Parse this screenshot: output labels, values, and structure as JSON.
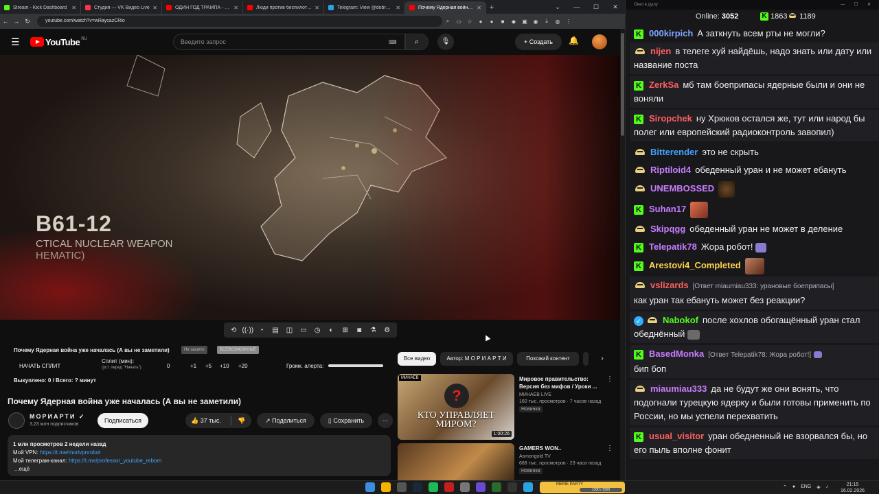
{
  "browser": {
    "tabs": [
      {
        "label": "Stream - Kick Dashboard",
        "color": "#53fc18"
      },
      {
        "label": "Студия — VK Видео Live",
        "color": "#ff3347"
      },
      {
        "label": "ОДИН ГОД ТРАМПА - YouTube",
        "color": "#ff0000"
      },
      {
        "label": "Люди против беспилотн: сем",
        "color": "#ff0000"
      },
      {
        "label": "Telegram: View @dobro_2ch",
        "color": "#2aa4e0"
      },
      {
        "label": "Почему Ядерная война у",
        "color": "#ff0000"
      }
    ],
    "url": "youtube.com/watch?v=wRaycazCRio"
  },
  "youtube": {
    "logo_text": "YouTube",
    "region": "RU",
    "search_placeholder": "Введите запрос",
    "create_label": "Создать",
    "video_overlay": {
      "line1": "B61-12",
      "line2": "CTICAL NUCLEAR WEAPON",
      "line3": "HEMATIC)"
    },
    "ext": {
      "title": "Почему Ядерная война уже началась (А вы не заметили)",
      "tag1": "Не зашито",
      "tag2": "ВСЕВОЗМОЖНЫЕ",
      "start_split": "НАЧАТЬ СПЛИТ",
      "split_label": "Сплит (мин):",
      "split_sub": "(уст. перед \"Начать\")",
      "zero": "0",
      "inc": [
        "+1",
        "+5",
        "+10",
        "+20"
      ],
      "loud_label": "Громк. алерта:",
      "bought": "Выкуплено: 0 / Всего: ? минут"
    },
    "video_title": "Почему Ядерная война уже началась (А вы не заметили)",
    "channel_name": "МОРИАРТИ",
    "channel_subs": "3,23 млн подписчиков",
    "subscribe_label": "Подписаться",
    "likes": "37 тыс.",
    "share_label": "Поделиться",
    "save_label": "Сохранить",
    "description": {
      "stats": "1 млн просмотров  2 недели назад",
      "vpn_label": "Мой VPN: ",
      "vpn_link": "https://t.me/morivpnrobot",
      "tg_label": "Мой телеграм-канал: ",
      "tg_link": "https://t.me/professor_youtube_reborn",
      "more": "...ещё"
    },
    "chips": [
      "Все видео",
      "Автор: М О Р И А Р Т И",
      "Похожий контент"
    ],
    "recommended": [
      {
        "title": "Мировое правительство: Версия без мифов / Уроки ...",
        "channel": "МИНАЕВ LIVE",
        "meta": "160 тыс. просмотров · 7 часов назад",
        "badge": "Новинка",
        "duration": "1:00:26",
        "thumb_badge": "МИНАЕВ",
        "thumb_text": "КТО УПРАВЛЯЕТ МИРОМ?"
      },
      {
        "title": "GAMERS WON..",
        "channel": "Asmongold TV",
        "meta": "668 тыс. просмотров · 23 часа назад",
        "badge": "Новинка"
      }
    ]
  },
  "chat": {
    "window_title": "Окно в душу",
    "online_label": "Online: ",
    "online_count": "3052",
    "kick_count": "1863",
    "yt_count": "1189",
    "messages": [
      {
        "user": "000kirpich",
        "color": "#7ea6ff",
        "badge": "kick",
        "text": "А заткнуть всем рты не могли?"
      },
      {
        "user": "nijen",
        "color": "#ff5f5f",
        "badge": "yt",
        "text": "в телеге хуй найдёшь, надо знать или дату или название поста"
      },
      {
        "user": "ZerkSa",
        "color": "#ff5f5f",
        "badge": "kick",
        "text": "мб там боеприпасы ядерные были и они не воняли"
      },
      {
        "user": "Siropchek",
        "color": "#ff5f5f",
        "badge": "kick",
        "text": "ну Хрюков остался же, тут или народ бы полег или европейский радиоконтроль завопил)"
      },
      {
        "user": "Bitterender",
        "color": "#3fa3ff",
        "badge": "yt",
        "text": "это не скрыть"
      },
      {
        "user": "Riptiloid4",
        "color": "#c77dff",
        "badge": "yt",
        "text": "обеденный уран и не может ебануть"
      },
      {
        "user": "UNEMBOSSED",
        "color": "#c77dff",
        "badge": "yt",
        "text": ""
      },
      {
        "user": "Suhan17",
        "color": "#c77dff",
        "badge": "kick",
        "text": ""
      },
      {
        "user": "Skipqgg",
        "color": "#c77dff",
        "badge": "yt",
        "text": "обеденный уран не может в деление"
      },
      {
        "user": "Telepatik78",
        "color": "#c77dff",
        "badge": "kick",
        "text": "Жора робот!"
      },
      {
        "user": "Arestovi4_Completed",
        "color": "#ffd24a",
        "badge": "kick",
        "text": ""
      },
      {
        "user": "vslizards",
        "color": "#ff5f5f",
        "badge": "yt",
        "reply": "[Ответ miaumiau333: урановые боеприпасы]",
        "text": "как уран так ебануть может без реакции?"
      },
      {
        "user": "Nabokof",
        "color": "#53fc18",
        "badge": "verified",
        "text": "после хохлов обогащённый уран стал обеднённый"
      },
      {
        "user": "BasedMonka",
        "color": "#c77dff",
        "badge": "kick",
        "reply": "[Ответ Telepatik78: Жора робот!]",
        "text": "бип боп"
      },
      {
        "user": "miaumiau333",
        "color": "#c77dff",
        "badge": "yt",
        "text": "да не будут же они вонять, что подогнали турецкую ядерку и были готовы применить по России, но мы успели перехватить"
      },
      {
        "user": "usual_visitor",
        "color": "#ff5f5f",
        "badge": "kick",
        "text": "уран обедненный не взорвался бы, но его пыль вполне фонит"
      }
    ]
  },
  "taskbar": {
    "meme_title": "MEME PARTY",
    "meme_progress": "1300 / 1500",
    "lang": "ENG",
    "time": "21:15",
    "date": "16.02.2026"
  }
}
